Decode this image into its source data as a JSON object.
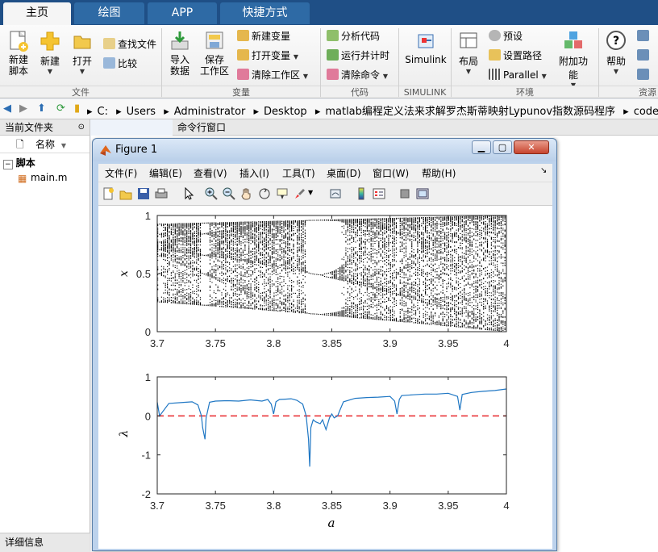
{
  "tabs": [
    {
      "label": "主页",
      "active": true
    },
    {
      "label": "绘图",
      "active": false
    },
    {
      "label": "APP",
      "active": false
    },
    {
      "label": "快捷方式",
      "active": false
    }
  ],
  "ribbon": {
    "file": {
      "new_script": "新建\n脚本",
      "new": "新建",
      "open": "打开",
      "find_files": "查找文件",
      "compare": "比较",
      "section": "文件"
    },
    "variable": {
      "import": "导入\n数据",
      "save_ws": "保存\n工作区",
      "new_var": "新建变量",
      "open_var": "打开变量",
      "clear_ws": "清除工作区",
      "section": "变量"
    },
    "code": {
      "analyze": "分析代码",
      "run_time": "运行并计时",
      "clear_cmds": "清除命令",
      "section": "代码"
    },
    "simulink": {
      "label": "Simulink",
      "section": "SIMULINK"
    },
    "env": {
      "layout": "布局",
      "prefs": "预设",
      "set_path": "设置路径",
      "parallel": "Parallel",
      "addons": "附加功能",
      "section": "环境"
    },
    "resources": {
      "help": "帮助",
      "section_partial": "资源"
    }
  },
  "address": {
    "crumbs": [
      "C:",
      "Users",
      "Administrator",
      "Desktop",
      "matlab编程定义法来求解罗杰斯蒂映射Lypunov指数源码程序",
      "code"
    ]
  },
  "left_panel": {
    "title": "当前文件夹",
    "col_name": "名称",
    "folder": "脚本",
    "file": "main.m",
    "details": "详细信息"
  },
  "command_window": {
    "title": "命令行窗口"
  },
  "figure": {
    "title": "Figure 1",
    "menus": [
      "文件(F)",
      "编辑(E)",
      "查看(V)",
      "插入(I)",
      "工具(T)",
      "桌面(D)",
      "窗口(W)",
      "帮助(H)"
    ]
  },
  "chart_data": [
    {
      "type": "scatter",
      "title": "",
      "xlabel": "",
      "ylabel": "x",
      "xlim": [
        3.7,
        4.0
      ],
      "ylim": [
        0,
        1
      ],
      "xticks": [
        "3.7",
        "3.75",
        "3.8",
        "3.85",
        "3.9",
        "3.95",
        "4"
      ],
      "yticks": [
        "0",
        "0.5",
        "1"
      ],
      "description_series": "logistic map bifurcation points x_n vs parameter a",
      "envelope": {
        "a": [
          3.7,
          3.75,
          3.8,
          3.85,
          3.9,
          3.95,
          4.0
        ],
        "x_min": [
          0.25,
          0.22,
          0.19,
          0.16,
          0.1,
          0.06,
          0.0
        ],
        "x_max": [
          0.925,
          0.9375,
          0.95,
          0.9625,
          0.975,
          0.9875,
          1.0
        ]
      },
      "windows": [
        {
          "a_start": 3.828,
          "a_end": 3.857,
          "note": "period-3 window"
        },
        {
          "a_start": 3.738,
          "a_end": 3.745,
          "note": "period-5 window"
        }
      ]
    },
    {
      "type": "line",
      "title": "",
      "xlabel": "a",
      "ylabel": "λ",
      "xlim": [
        3.7,
        4.0
      ],
      "ylim": [
        -2,
        1
      ],
      "xticks": [
        "3.7",
        "3.75",
        "3.8",
        "3.85",
        "3.9",
        "3.95",
        "4"
      ],
      "yticks": [
        "-2",
        "-1",
        "0",
        "1"
      ],
      "reference_line": {
        "y": 0,
        "style": "dashed",
        "color": "#e8262b"
      },
      "series": [
        {
          "color": "#1f77c4",
          "x": [
            3.7,
            3.702,
            3.71,
            3.72,
            3.73,
            3.735,
            3.738,
            3.739,
            3.741,
            3.742,
            3.745,
            3.75,
            3.76,
            3.77,
            3.78,
            3.79,
            3.795,
            3.798,
            3.8,
            3.802,
            3.805,
            3.81,
            3.815,
            3.82,
            3.825,
            3.828,
            3.83,
            3.831,
            3.832,
            3.834,
            3.836,
            3.84,
            3.842,
            3.845,
            3.848,
            3.85,
            3.852,
            3.855,
            3.857,
            3.86,
            3.87,
            3.88,
            3.89,
            3.9,
            3.904,
            3.906,
            3.908,
            3.91,
            3.92,
            3.93,
            3.94,
            3.95,
            3.958,
            3.96,
            3.962,
            3.97,
            3.98,
            3.99,
            4.0
          ],
          "y": [
            0.35,
            0.0,
            0.32,
            0.34,
            0.36,
            0.28,
            0.0,
            -0.3,
            -0.6,
            -0.05,
            0.35,
            0.38,
            0.39,
            0.38,
            0.41,
            0.38,
            0.42,
            0.3,
            0.05,
            0.36,
            0.42,
            0.43,
            0.44,
            0.4,
            0.3,
            0.0,
            -0.6,
            -1.3,
            -0.3,
            -0.1,
            -0.15,
            -0.2,
            -0.1,
            -0.35,
            -0.05,
            0.05,
            -0.05,
            0.0,
            0.15,
            0.36,
            0.45,
            0.47,
            0.48,
            0.5,
            0.38,
            0.05,
            0.42,
            0.52,
            0.54,
            0.56,
            0.56,
            0.58,
            0.5,
            0.15,
            0.55,
            0.6,
            0.63,
            0.65,
            0.69
          ]
        }
      ]
    }
  ]
}
